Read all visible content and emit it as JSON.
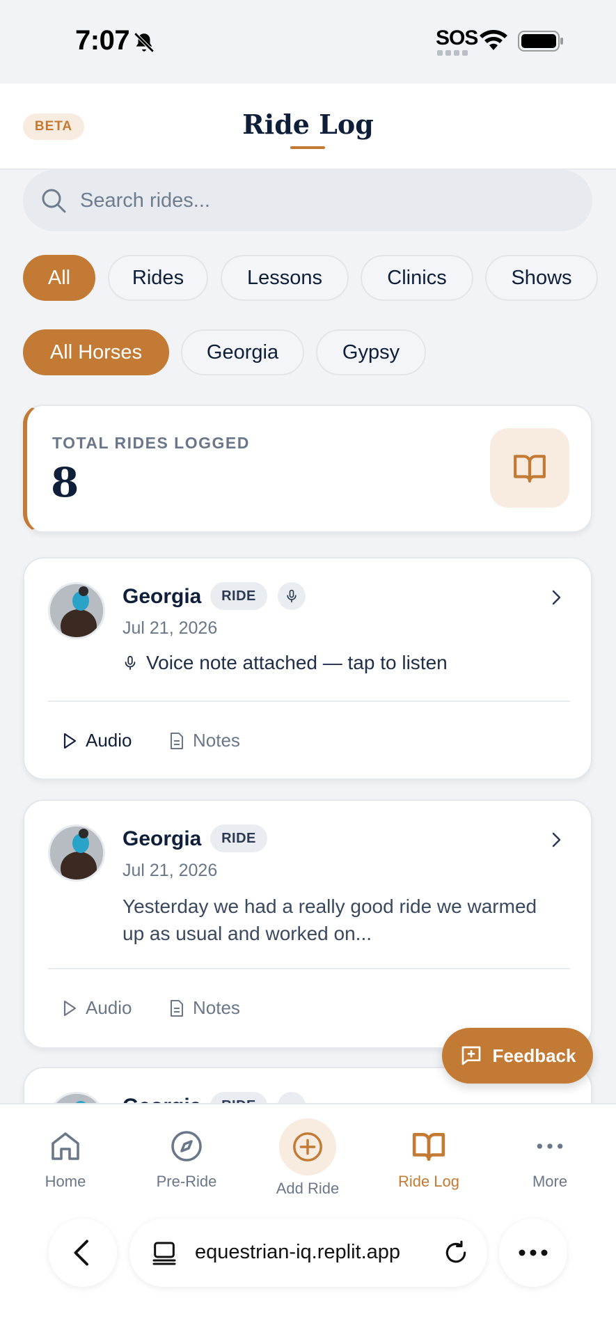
{
  "status_bar": {
    "time": "7:07",
    "sos": "SOS"
  },
  "header": {
    "beta": "BETA",
    "title": "Ride Log"
  },
  "search": {
    "placeholder": "Search rides..."
  },
  "type_filters": [
    "All",
    "Rides",
    "Lessons",
    "Clinics",
    "Shows"
  ],
  "horse_filters": [
    "All Horses",
    "Georgia",
    "Gypsy"
  ],
  "summary": {
    "label": "TOTAL RIDES LOGGED",
    "value": "8"
  },
  "rides": [
    {
      "horse": "Georgia",
      "tag": "RIDE",
      "date": "Jul 21, 2026",
      "voice_note": "Voice note attached — tap to listen",
      "audio_label": "Audio",
      "notes_label": "Notes"
    },
    {
      "horse": "Georgia",
      "tag": "RIDE",
      "date": "Jul 21, 2026",
      "excerpt": "Yesterday we had a really good ride we warmed up as usual and worked on...",
      "audio_label": "Audio",
      "notes_label": "Notes"
    },
    {
      "horse": "Georgia",
      "tag": "RIDE"
    }
  ],
  "feedback_label": "Feedback",
  "bottom_nav": [
    "Home",
    "Pre-Ride",
    "Add Ride",
    "Ride Log",
    "More"
  ],
  "browser": {
    "url": "equestrian-iq.replit.app"
  },
  "colors": {
    "accent": "#c27a34",
    "navy": "#0f1f3a",
    "muted": "#6a7789"
  }
}
